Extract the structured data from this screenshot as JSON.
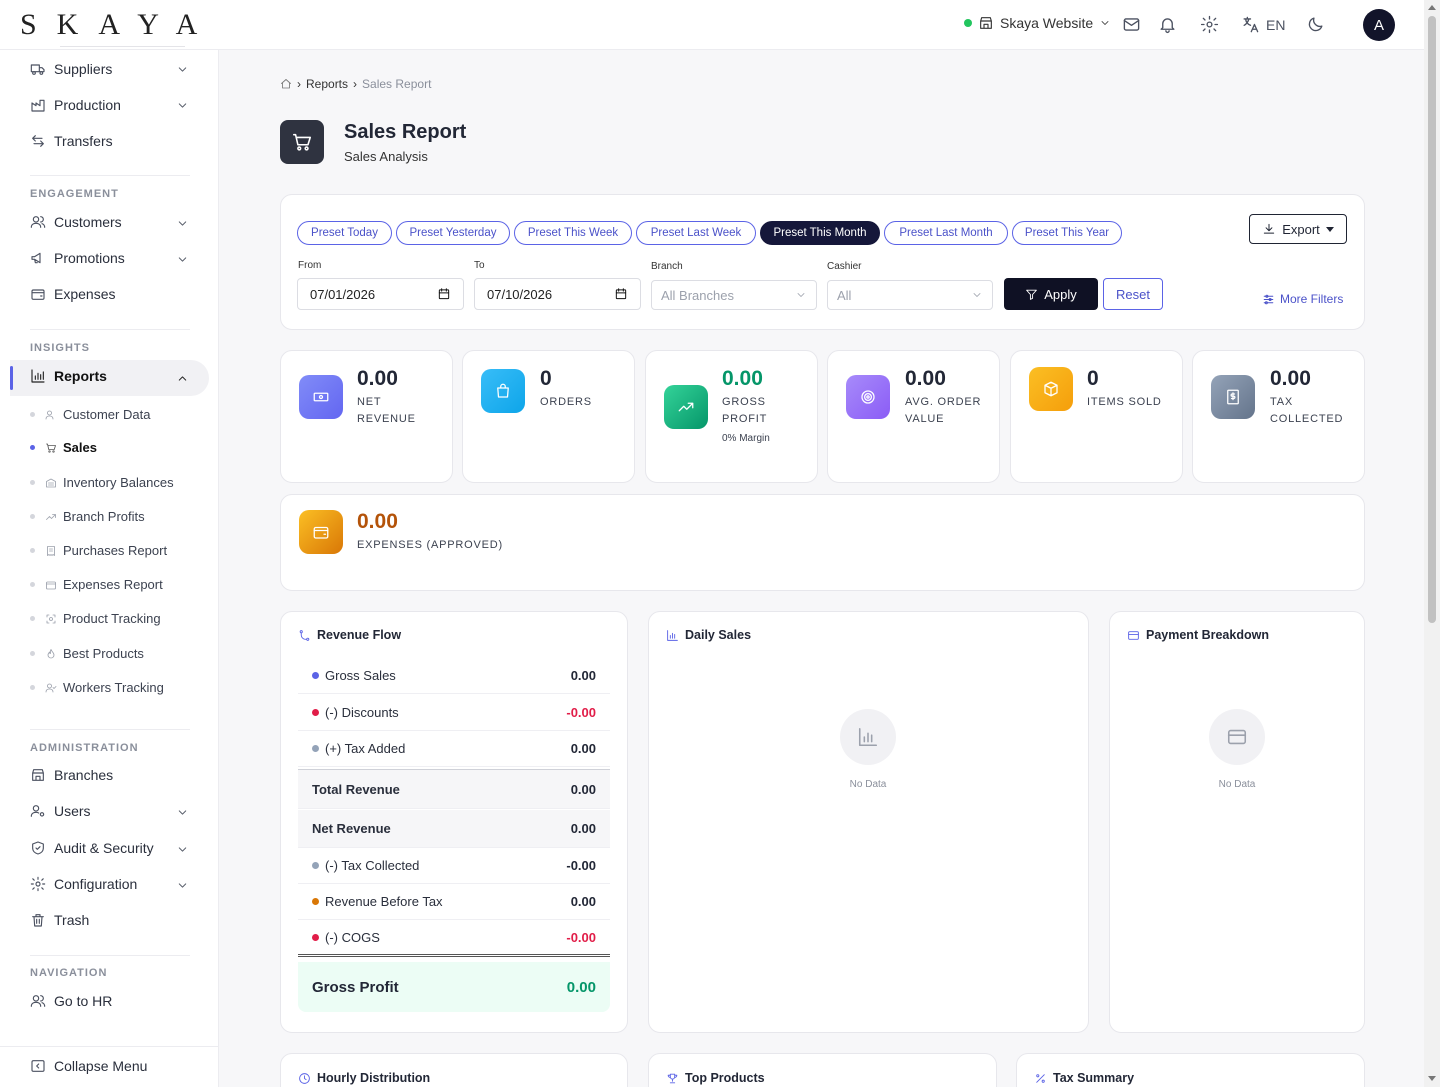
{
  "app": {
    "logo": "SKAYA"
  },
  "topbar": {
    "store": "Skaya Website",
    "language": "EN",
    "avatar_initial": "A"
  },
  "sidebar": {
    "top_items": [
      {
        "label": "Suppliers"
      },
      {
        "label": "Production"
      },
      {
        "label": "Transfers"
      }
    ],
    "sections": {
      "engagement": "ENGAGEMENT",
      "insights": "INSIGHTS",
      "administration": "ADMINISTRATION",
      "navigation": "NAVIGATION"
    },
    "engagement_items": [
      {
        "label": "Customers"
      },
      {
        "label": "Promotions"
      },
      {
        "label": "Expenses"
      }
    ],
    "reports_label": "Reports",
    "report_sub": [
      {
        "label": "Customer Data"
      },
      {
        "label": "Sales"
      },
      {
        "label": "Inventory Balances"
      },
      {
        "label": "Branch Profits"
      },
      {
        "label": "Purchases Report"
      },
      {
        "label": "Expenses Report"
      },
      {
        "label": "Product Tracking"
      },
      {
        "label": "Best Products"
      },
      {
        "label": "Workers Tracking"
      }
    ],
    "admin_items": [
      {
        "label": "Branches"
      },
      {
        "label": "Users"
      },
      {
        "label": "Audit & Security"
      },
      {
        "label": "Configuration"
      },
      {
        "label": "Trash"
      }
    ],
    "nav_items": [
      {
        "label": "Go to HR"
      }
    ],
    "collapse_label": "Collapse Menu"
  },
  "breadcrumb": {
    "parent": "Reports",
    "current": "Sales Report"
  },
  "page": {
    "title": "Sales Report",
    "subtitle": "Sales Analysis"
  },
  "filters": {
    "presets": [
      "Preset Today",
      "Preset Yesterday",
      "Preset This Week",
      "Preset Last Week",
      "Preset This Month",
      "Preset Last Month",
      "Preset This Year"
    ],
    "active_preset": "Preset This Month",
    "export_label": "Export",
    "from_label": "From",
    "from_value": "07/01/2026",
    "to_label": "To",
    "to_value": "07/10/2026",
    "branch_label": "Branch",
    "branch_value": "All Branches",
    "cashier_label": "Cashier",
    "cashier_value": "All",
    "apply_label": "Apply",
    "reset_label": "Reset",
    "more_filters_label": "More Filters"
  },
  "stats": [
    {
      "value": "0.00",
      "label": "NET REVENUE",
      "color": "#6366f1"
    },
    {
      "value": "0",
      "label": "ORDERS",
      "color": "#0ea5e9"
    },
    {
      "value": "0.00",
      "label": "GROSS PROFIT",
      "extra": "0% Margin",
      "color": "#10b981",
      "value_color": "#059669"
    },
    {
      "value": "0.00",
      "label": "AVG. ORDER VALUE",
      "color": "#8b5cf6"
    },
    {
      "value": "0",
      "label": "ITEMS SOLD",
      "color": "#f59e0b"
    },
    {
      "value": "0.00",
      "label": "TAX COLLECTED",
      "color": "#64748b"
    }
  ],
  "expenses_stat": {
    "value": "0.00",
    "label": "EXPENSES (APPROVED)",
    "color": "#f59e0b",
    "value_color": "#b45309"
  },
  "revenue_flow": {
    "title": "Revenue Flow",
    "rows": [
      {
        "label": "Gross Sales",
        "value": "0.00",
        "dot": "#5b63e6"
      },
      {
        "label": "(-) Discounts",
        "value": "-0.00",
        "dot": "#e11d48"
      },
      {
        "label": "(+) Tax Added",
        "value": "0.00",
        "dot": "#94a3b8"
      },
      {
        "label": "Total Revenue",
        "value": "0.00"
      },
      {
        "label": "Net Revenue",
        "value": "0.00"
      },
      {
        "label": "(-) Tax Collected",
        "value": "-0.00",
        "dot": "#94a3b8"
      },
      {
        "label": "Revenue Before Tax",
        "value": "0.00",
        "dot": "#d97706"
      },
      {
        "label": "(-) COGS",
        "value": "-0.00",
        "dot": "#e11d48"
      }
    ],
    "gross_profit_label": "Gross Profit",
    "gross_profit_value": "0.00"
  },
  "daily_sales": {
    "title": "Daily Sales",
    "empty": "No Data"
  },
  "payment_breakdown": {
    "title": "Payment Breakdown",
    "empty": "No Data"
  },
  "bottom_sections": [
    "Hourly Distribution",
    "Top Products",
    "Tax Summary"
  ]
}
